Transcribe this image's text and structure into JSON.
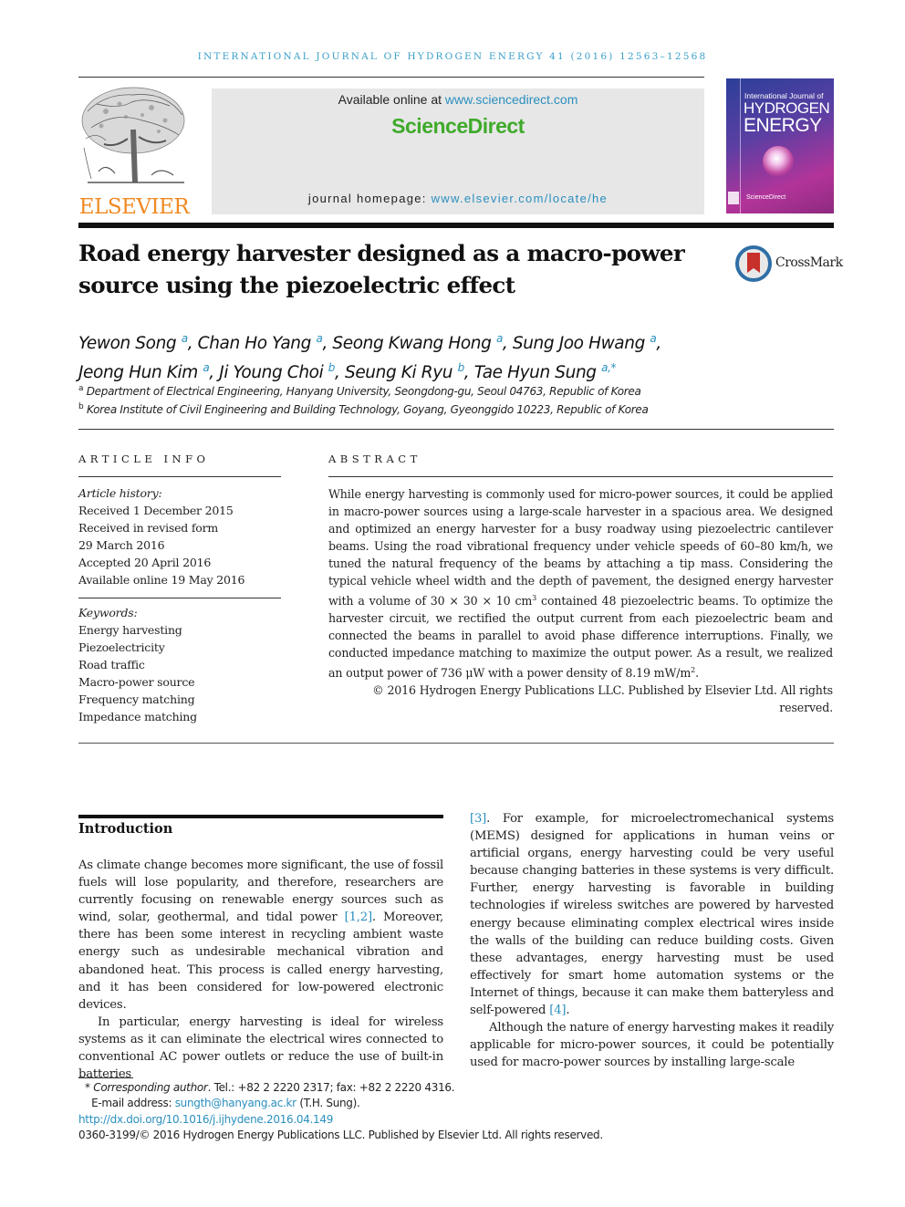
{
  "running_head": "INTERNATIONAL JOURNAL OF HYDROGEN ENERGY 41 (2016) 12563–12568",
  "publisher": {
    "logo_icon": "elsevier-tree-icon",
    "name": "ELSEVIER"
  },
  "sciencedirect": {
    "available_prefix": "Available online at ",
    "available_link": "www.sciencedirect.com",
    "brand": "ScienceDirect",
    "homepage_prefix": "journal homepage: ",
    "homepage_link": "www.elsevier.com/locate/he"
  },
  "journal_cover": {
    "small_title": "International Journal of",
    "title_line1": "HYDROGEN",
    "title_line2": "ENERGY",
    "footer": "ScienceDirect"
  },
  "article": {
    "title": "Road energy harvester designed as a macro-power source using the piezoelectric effect",
    "crossmark_label": "CrossMark",
    "authors": [
      {
        "name": "Yewon Song",
        "affil": "a"
      },
      {
        "name": "Chan Ho Yang",
        "affil": "a"
      },
      {
        "name": "Seong Kwang Hong",
        "affil": "a"
      },
      {
        "name": "Sung Joo Hwang",
        "affil": "a"
      },
      {
        "name": "Jeong Hun Kim",
        "affil": "a"
      },
      {
        "name": "Ji Young Choi",
        "affil": "b"
      },
      {
        "name": "Seung Ki Ryu",
        "affil": "b"
      },
      {
        "name": "Tae Hyun Sung",
        "affil": "a,*"
      }
    ],
    "affiliations": [
      {
        "key": "a",
        "text": "Department of Electrical Engineering, Hanyang University, Seongdong-gu, Seoul 04763, Republic of Korea"
      },
      {
        "key": "b",
        "text": "Korea Institute of Civil Engineering and Building Technology, Goyang, Gyeonggido 10223, Republic of Korea"
      }
    ]
  },
  "article_info": {
    "heading": "ARTICLE INFO",
    "history_label": "Article history:",
    "history": [
      "Received 1 December 2015",
      "Received in revised form",
      "29 March 2016",
      "Accepted 20 April 2016",
      "Available online 19 May 2016"
    ],
    "keywords_label": "Keywords:",
    "keywords": [
      "Energy harvesting",
      "Piezoelectricity",
      "Road traffic",
      "Macro-power source",
      "Frequency matching",
      "Impedance matching"
    ]
  },
  "abstract": {
    "heading": "ABSTRACT",
    "text_part1": "While energy harvesting is commonly used for micro-power sources, it could be applied in macro-power sources using a large-scale harvester in a spacious area. We designed and optimized an energy harvester for a busy roadway using piezoelectric cantilever beams. Using the road vibrational frequency under vehicle speeds of 60–80 km/h, we tuned the natural frequency of the beams by attaching a tip mass. Considering the typical vehicle wheel width and the depth of pavement, the designed energy harvester with a volume of 30 × 30 × 10 cm",
    "sup1": "3",
    "text_part2": " contained 48 piezoelectric beams. To optimize the harvester circuit, we rectified the output current from each piezoelectric beam and connected the beams in parallel to avoid phase difference interruptions. Finally, we conducted impedance matching to maximize the output power. As a result, we realized an output power of 736 μW with a power density of 8.19 mW/m",
    "sup2": "2",
    "text_part3": ".",
    "copyright": "© 2016 Hydrogen Energy Publications LLC. Published by Elsevier Ltd. All rights reserved."
  },
  "introduction": {
    "heading": "Introduction",
    "p1_a": "As climate change becomes more significant, the use of fossil fuels will lose popularity, and therefore, researchers are currently focusing on renewable energy sources such as wind, solar, geothermal, and tidal power ",
    "p1_ref": "[1,2]",
    "p1_b": ". Moreover, there has been some interest in recycling ambient waste energy such as undesirable mechanical vibration and abandoned heat. This process is called energy harvesting, and it has been considered for low-powered electronic devices.",
    "p2_a": "In particular, energy harvesting is ideal for wireless systems as it can eliminate the electrical wires connected to conventional AC power outlets or reduce the use of built-in batteries ",
    "p2_ref1": "[3]",
    "p2_b": ". For example, for microelectromechanical systems (MEMS) designed for applications in human veins or artificial organs, energy harvesting could be very useful because changing batteries in these systems is very difficult. Further, energy harvesting is favorable in building technologies if wireless switches are powered by harvested energy because eliminating complex electrical wires inside the walls of the building can reduce building costs. Given these advantages, energy harvesting must be used effectively for smart home automation systems or the Internet of things, because it can make them batteryless and self-powered ",
    "p2_ref2": "[4]",
    "p2_c": ".",
    "p3": "Although the nature of energy harvesting makes it readily applicable for micro-power sources, it could be potentially used for macro-power sources by installing large-scale"
  },
  "footnotes": {
    "corresponding_marker": "*",
    "corresponding_label": "Corresponding author",
    "contact": ". Tel.: +82 2 2220 2317; fax: +82 2 2220 4316.",
    "email_label": "E-mail address: ",
    "email": "sungth@hanyang.ac.kr",
    "email_suffix": " (T.H. Sung).",
    "doi": "http://dx.doi.org/10.1016/j.ijhydene.2016.04.149",
    "issn_line": "0360-3199/© 2016 Hydrogen Energy Publications LLC. Published by Elsevier Ltd. All rights reserved."
  }
}
